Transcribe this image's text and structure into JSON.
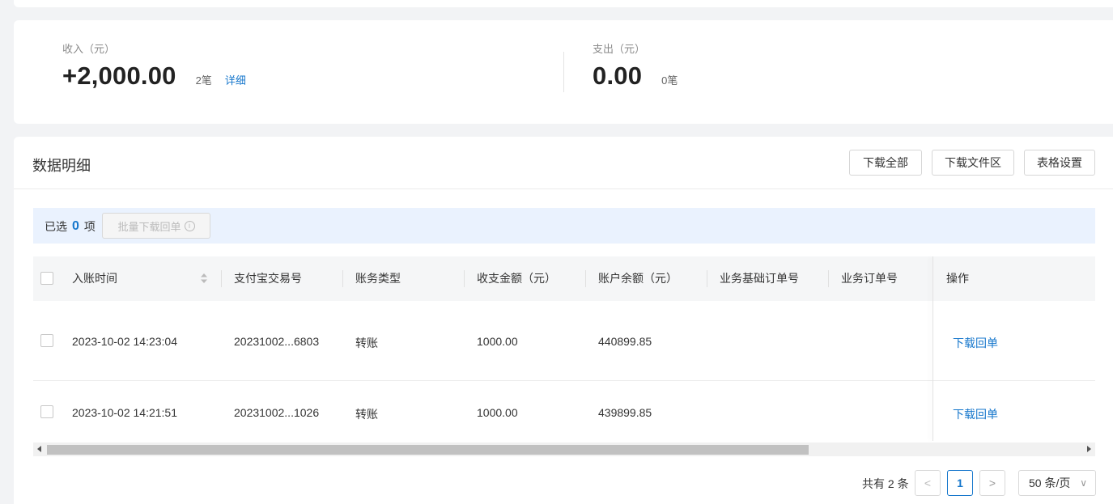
{
  "summary": {
    "income_label": "收入（元）",
    "income_amount": "+2,000.00",
    "income_count": "2笔",
    "income_detail_link": "详细",
    "expense_label": "支出（元）",
    "expense_amount": "0.00",
    "expense_count": "0笔"
  },
  "detail": {
    "title": "数据明细",
    "buttons": {
      "download_all": "下载全部",
      "download_files": "下载文件区",
      "table_settings": "表格设置"
    },
    "selection": {
      "prefix": "已选",
      "count": "0",
      "suffix": "项",
      "batch_download": "批量下载回单"
    }
  },
  "table": {
    "columns": [
      "入账时间",
      "支付宝交易号",
      "账务类型",
      "收支金额（元）",
      "账户余额（元）",
      "业务基础订单号",
      "业务订单号",
      "操作"
    ],
    "rows": [
      {
        "time": "2023-10-02 14:23:04",
        "trade_no": "20231002...6803",
        "type": "转账",
        "amount": "1000.00",
        "balance": "440899.85",
        "base_order": "",
        "order": "",
        "action": "下载回单"
      },
      {
        "time": "2023-10-02 14:21:51",
        "trade_no": "20231002...1026",
        "type": "转账",
        "amount": "1000.00",
        "balance": "439899.85",
        "base_order": "",
        "order": "",
        "action": "下载回单"
      }
    ]
  },
  "pagination": {
    "total_text": "共有 2 条",
    "prev_symbol": "<",
    "current_page": "1",
    "next_symbol": ">",
    "page_size": "50 条/页",
    "page_size_chevron": "∨"
  },
  "colors": {
    "accent": "#1677cc",
    "selection_bar": "#eaf2fe",
    "header_bg": "#f5f6f7"
  }
}
